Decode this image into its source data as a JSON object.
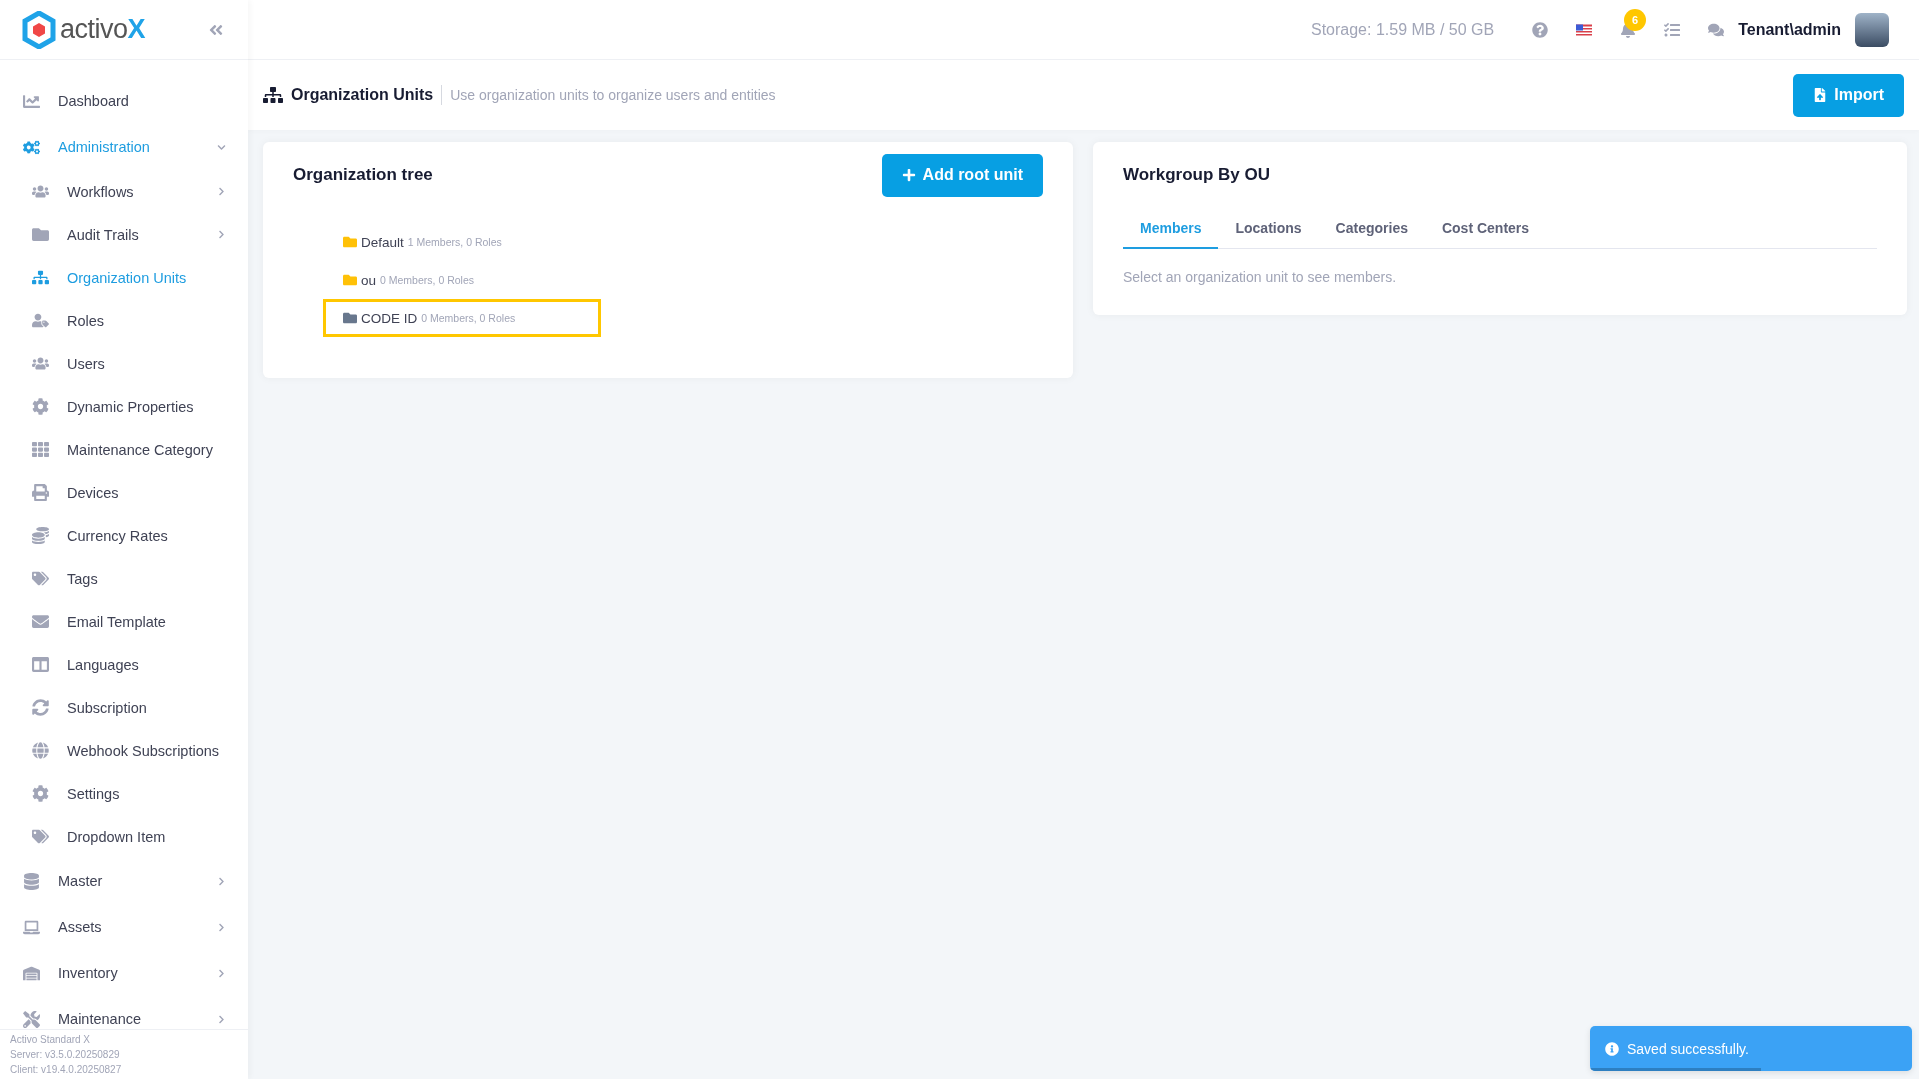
{
  "logo": {
    "text": "activo",
    "accent": "X"
  },
  "header": {
    "storage": "Storage: 1.59 MB / 50 GB",
    "notifications": "6",
    "user": "Tenant\\admin"
  },
  "sidebar": {
    "items": [
      {
        "label": "Dashboard",
        "selected": false
      },
      {
        "label": "Administration",
        "selected": true,
        "expanded": true,
        "children": [
          {
            "label": "Workflows",
            "selected": false,
            "expanded": false
          },
          {
            "label": "Audit Trails",
            "selected": false,
            "expanded": false
          },
          {
            "label": "Organization Units",
            "selected": true
          },
          {
            "label": "Roles",
            "selected": false
          },
          {
            "label": "Users",
            "selected": false
          },
          {
            "label": "Dynamic Properties",
            "selected": false
          },
          {
            "label": "Maintenance Category",
            "selected": false
          },
          {
            "label": "Devices",
            "selected": false
          },
          {
            "label": "Currency Rates",
            "selected": false
          },
          {
            "label": "Tags",
            "selected": false
          },
          {
            "label": "Email Template",
            "selected": false
          },
          {
            "label": "Languages",
            "selected": false
          },
          {
            "label": "Subscription",
            "selected": false
          },
          {
            "label": "Webhook Subscriptions",
            "selected": false
          },
          {
            "label": "Settings",
            "selected": false
          },
          {
            "label": "Dropdown Item",
            "selected": false
          }
        ]
      },
      {
        "label": "Master",
        "selected": false,
        "expanded": false
      },
      {
        "label": "Assets",
        "selected": false,
        "expanded": false
      },
      {
        "label": "Inventory",
        "selected": false,
        "expanded": false
      },
      {
        "label": "Maintenance",
        "selected": false,
        "expanded": false
      }
    ],
    "footer": [
      "Activo Standard X",
      "Server: v3.5.0.20250829",
      "Client: v19.4.0.20250827"
    ]
  },
  "page": {
    "title": "Organization Units",
    "subtitle": "Use organization units to organize users and entities",
    "import_button": "Import"
  },
  "tree_card": {
    "title": "Organization tree",
    "add_button": "Add root unit",
    "units": [
      {
        "name": "Default",
        "info": "1 Members, 0 Roles",
        "selected": false
      },
      {
        "name": "ou",
        "info": "0 Members, 0 Roles",
        "selected": false
      },
      {
        "name": "CODE ID",
        "info": "0 Members, 0 Roles",
        "selected": true
      }
    ]
  },
  "workgroup_card": {
    "title": "Workgroup By OU",
    "tabs": [
      {
        "label": "Members",
        "selected": true
      },
      {
        "label": "Locations",
        "selected": false
      },
      {
        "label": "Categories",
        "selected": false
      },
      {
        "label": "Cost Centers",
        "selected": false
      }
    ],
    "empty_text": "Select an organization unit to see members."
  },
  "toast": {
    "message": "Saved successfully.",
    "level": 0.53
  }
}
